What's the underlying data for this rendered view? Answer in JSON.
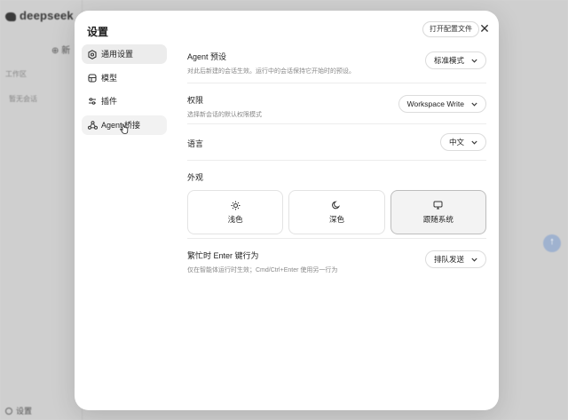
{
  "background": {
    "brand": "deepseek",
    "new_chat": "新",
    "workspace": "工作区",
    "no_sessions": "暂无会话",
    "settings": "设置"
  },
  "modal": {
    "title": "设置",
    "open_config_label": "打开配置文件",
    "close_label": "✕"
  },
  "nav": {
    "items": [
      {
        "label": "通用设置",
        "icon": "hexagon-gear-icon",
        "active": true
      },
      {
        "label": "模型",
        "icon": "model-icon"
      },
      {
        "label": "插件",
        "icon": "sliders-icon"
      },
      {
        "label": "Agent 桥接",
        "icon": "bridge-icon"
      }
    ]
  },
  "settings": {
    "agent_preset": {
      "label": "Agent 预设",
      "description": "对此后新建的会话生效。运行中的会话保持它开始时的预设。",
      "value": "标准模式"
    },
    "permission": {
      "label": "权限",
      "description": "选择新会话的默认权限模式",
      "value": "Workspace Write"
    },
    "language": {
      "label": "语言",
      "value": "中文"
    },
    "appearance": {
      "label": "外观",
      "options": [
        {
          "label": "浅色",
          "icon": "sun-icon"
        },
        {
          "label": "深色",
          "icon": "moon-icon"
        },
        {
          "label": "跟随系统",
          "icon": "monitor-icon",
          "selected": true
        }
      ]
    },
    "busy_enter": {
      "label": "繁忙时 Enter 键行为",
      "description": "仅在智能体运行时生效；Cmd/Ctrl+Enter 使用另一行为",
      "value": "排队发送"
    }
  },
  "colors": {
    "overlay": "#cfcfcf",
    "selected_bg": "#ececec",
    "accent_send": "#9fb2cf"
  }
}
